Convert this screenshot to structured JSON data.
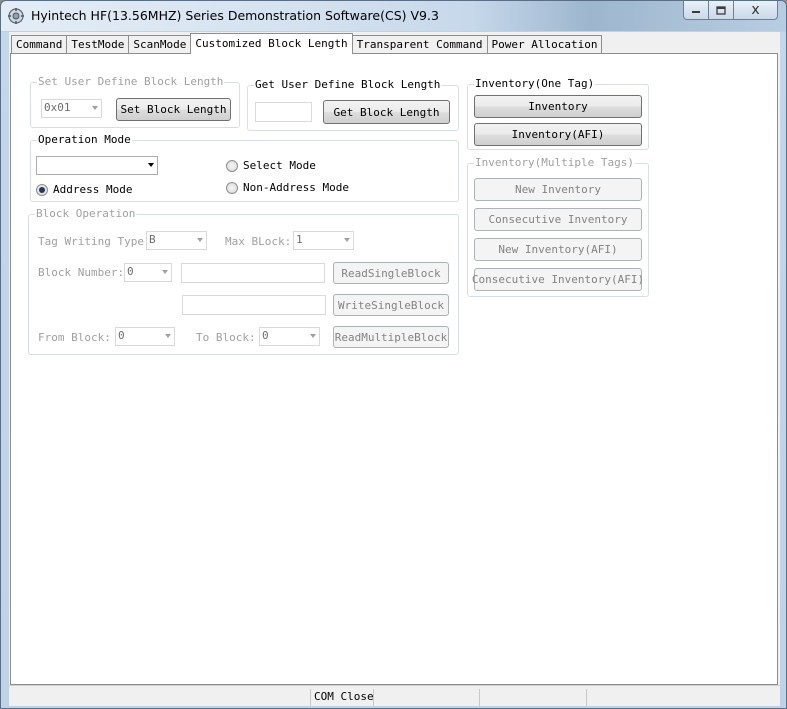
{
  "window": {
    "title": "Hyintech HF(13.56MHZ) Series Demonstration Software(CS) V9.3",
    "icon": "app-gear-icon",
    "controls": {
      "minimize": "minimize-icon",
      "maximize": "maximize-icon",
      "close": "close-icon",
      "close_glyph": "x"
    }
  },
  "tabs": [
    {
      "label": "Command"
    },
    {
      "label": "TestMode"
    },
    {
      "label": "ScanMode"
    },
    {
      "label": "Customized Block Length",
      "active": true
    },
    {
      "label": "Transparent Command"
    },
    {
      "label": "Power Allocation"
    }
  ],
  "set_block": {
    "legend": "Set User Define Block Length",
    "combo_value": "0x01",
    "button": "Set Block Length"
  },
  "get_block": {
    "legend": "Get User Define Block Length",
    "value": "",
    "button": "Get Block Length"
  },
  "operation_mode": {
    "legend": "Operation Mode",
    "combo_value": "",
    "select_mode": "Select Mode",
    "address_mode": "Address Mode",
    "non_address_mode": "Non-Address Mode",
    "selected": "Address Mode"
  },
  "block_operation": {
    "legend": "Block Operation",
    "tag_writing_type_label": "Tag Writing Type:",
    "tag_writing_type_value": "B",
    "max_block_label": "Max BLock:",
    "max_block_value": "1",
    "block_number_label": "Block Number:",
    "block_number_value": "0",
    "read_single": "ReadSingleBlock",
    "write_single": "WriteSingleBlock",
    "from_block_label": "From Block:",
    "from_block_value": "0",
    "to_block_label": "To Block:",
    "to_block_value": "0",
    "read_multiple": "ReadMultipleBlock"
  },
  "inventory_one": {
    "legend": "Inventory(One Tag)",
    "inventory": "Inventory",
    "inventory_afi": "Inventory(AFI)"
  },
  "inventory_multi": {
    "legend": "Inventory(Multiple Tags)",
    "new_inventory": "New Inventory",
    "consecutive_inventory": "Consecutive  Inventory",
    "new_inventory_afi": "New Inventory(AFI)",
    "consecutive_inventory_afi": "Consecutive Inventory(AFI)"
  },
  "statusbar": {
    "panels": [
      "",
      "COM Close",
      "",
      "",
      ""
    ]
  }
}
